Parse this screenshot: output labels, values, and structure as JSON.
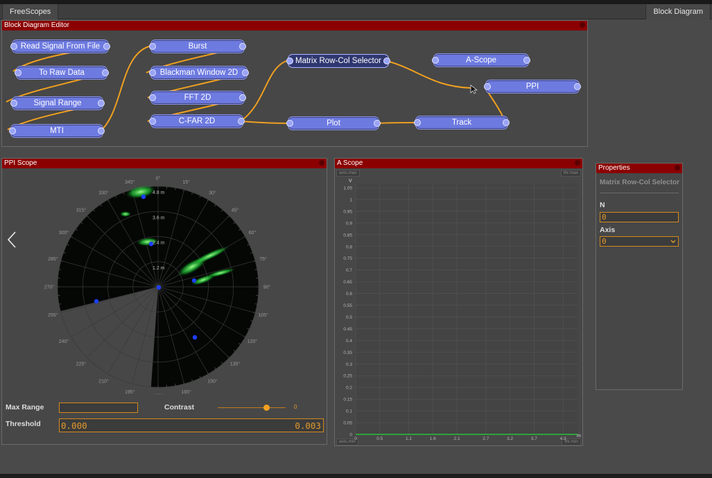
{
  "topbar": {
    "left_tab": "FreeScopes",
    "right_tab": "Block Diagram"
  },
  "editor": {
    "title": "Block Diagram Editor",
    "nodes": [
      {
        "id": "read",
        "label": "Read Signal From File"
      },
      {
        "id": "raw",
        "label": "To Raw Data"
      },
      {
        "id": "range",
        "label": "Signal Range"
      },
      {
        "id": "mti",
        "label": "MTI"
      },
      {
        "id": "burst",
        "label": "Burst"
      },
      {
        "id": "blackman",
        "label": "Blackman Window 2D"
      },
      {
        "id": "fft",
        "label": "FFT 2D"
      },
      {
        "id": "cfar",
        "label": "C-FAR 2D"
      },
      {
        "id": "matrix",
        "label": "Matrix Row-Col Selector"
      },
      {
        "id": "plot",
        "label": "Plot"
      },
      {
        "id": "ascope",
        "label": "A-Scope"
      },
      {
        "id": "ppi",
        "label": "PPI"
      },
      {
        "id": "track",
        "label": "Track"
      }
    ]
  },
  "ppi": {
    "title": "PPI Scope",
    "angles": [
      "0°",
      "15°",
      "30°",
      "45°",
      "60°",
      "75°",
      "90°",
      "105°",
      "120°",
      "135°",
      "150°",
      "165°",
      "180°",
      "195°",
      "210°",
      "225°",
      "240°",
      "255°",
      "270°",
      "285°",
      "300°",
      "315°",
      "330°",
      "345°"
    ],
    "ranges": [
      "4.8 m",
      "3.6 m",
      "2.4 m",
      "1.2 m"
    ],
    "max_range_label": "Max Range",
    "max_range_value": "",
    "contrast_label": "Contrast",
    "contrast_value": "0",
    "contrast_level": 0.72,
    "threshold_label": "Threshold",
    "threshold_value": "0.000",
    "threshold_right": "0.003"
  },
  "ascope": {
    "title": "A Scope",
    "tag_axis_max": "axis.max",
    "tag_thr_max": "thr.max",
    "tag_axis_min": "axis.min",
    "tag_thr_min": "thr.min",
    "ylabel": "V",
    "xlabel": "m",
    "yticks": [
      "1.05",
      "1",
      "0.95",
      "0.9",
      "0.85",
      "0.8",
      "0.75",
      "0.7",
      "0.65",
      "0.6",
      "0.55",
      "0.5",
      "0.45",
      "0.4",
      "0.35",
      "0.3",
      "0.25",
      "0.2",
      "0.15",
      "0.1",
      "0.05",
      "0"
    ],
    "xticks": [
      "0",
      "0.5",
      "1.1",
      "1.6",
      "2.1",
      "2.7",
      "3.2",
      "3.7",
      "4.3"
    ]
  },
  "properties": {
    "title": "Properties",
    "heading": "Matrix Row-Col Selector",
    "n_label": "N",
    "n_value": "0",
    "axis_label": "Axis",
    "axis_value": "0"
  },
  "colors": {
    "accent": "#d4891d",
    "titlebar": "#8b0000",
    "node": "#6d7ae0",
    "wire": "#f0a020",
    "radar": "#1fd93a"
  }
}
